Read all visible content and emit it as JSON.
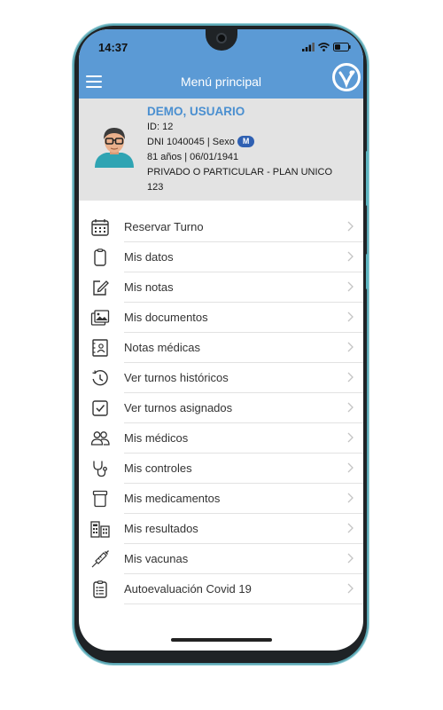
{
  "status_bar": {
    "time": "14:37"
  },
  "app_bar": {
    "title": "Menú principal"
  },
  "profile": {
    "name": "DEMO, USUARIO",
    "id_line": "ID: 12",
    "dni_line": "DNI 1040045 | Sexo",
    "sex": "M",
    "age_line": "81 años | 06/01/1941",
    "plan_line": "PRIVADO O PARTICULAR - PLAN UNICO",
    "plan_number": "123"
  },
  "menu": {
    "items": [
      {
        "label": "Reservar Turno",
        "icon": "calendar-icon"
      },
      {
        "label": "Mis datos",
        "icon": "clipboard-icon"
      },
      {
        "label": "Mis notas",
        "icon": "edit-note-icon"
      },
      {
        "label": "Mis documentos",
        "icon": "image-documents-icon"
      },
      {
        "label": "Notas médicas",
        "icon": "medical-notes-icon"
      },
      {
        "label": "Ver turnos históricos",
        "icon": "history-icon"
      },
      {
        "label": "Ver turnos asignados",
        "icon": "checkbox-icon"
      },
      {
        "label": "Mis médicos",
        "icon": "people-icon"
      },
      {
        "label": "Mis controles",
        "icon": "stethoscope-icon"
      },
      {
        "label": "Mis medicamentos",
        "icon": "medication-icon"
      },
      {
        "label": "Mis resultados",
        "icon": "results-icon"
      },
      {
        "label": "Mis vacunas",
        "icon": "syringe-icon"
      },
      {
        "label": "Autoevaluación Covid 19",
        "icon": "checklist-icon"
      }
    ]
  },
  "colors": {
    "primary": "#5b9ad5",
    "profile_bg": "#e3e3e3",
    "name": "#4a8fd0",
    "badge": "#2f60b2"
  }
}
